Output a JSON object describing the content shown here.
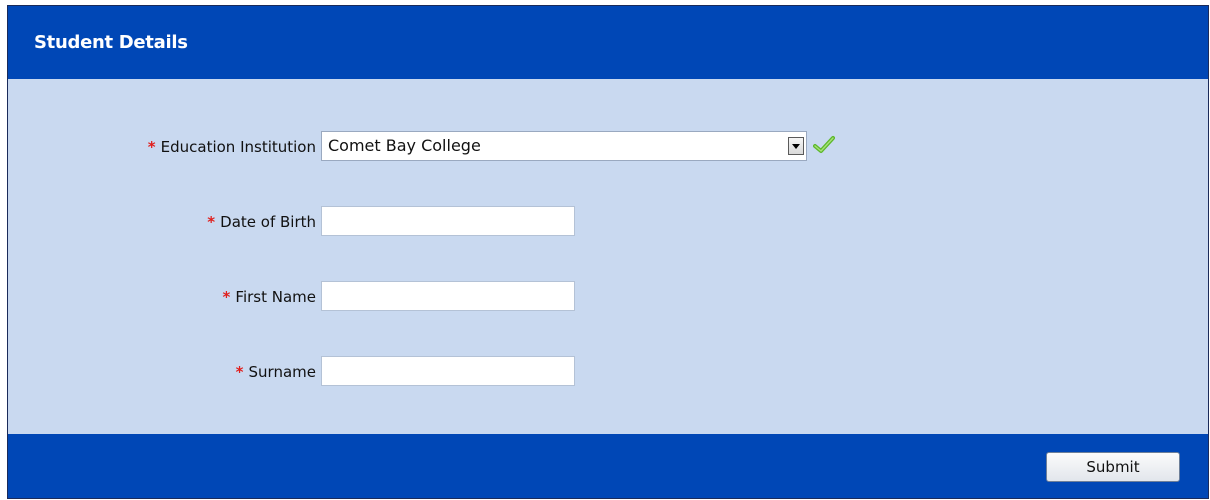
{
  "header": {
    "title": "Student Details"
  },
  "form": {
    "required_marker": "*",
    "institution": {
      "label": "Education Institution",
      "selected_value": "Comet Bay College"
    },
    "dob": {
      "label": "Date of Birth",
      "value": ""
    },
    "first_name": {
      "label": "First Name",
      "value": ""
    },
    "surname": {
      "label": "Surname",
      "value": ""
    }
  },
  "footer": {
    "submit_label": "Submit"
  },
  "colors": {
    "header_bg": "#0047b6",
    "panel_bg": "#c9d9f0",
    "required": "#e0201e",
    "valid_check": "#5cb82a"
  },
  "icons": {
    "institution_status": "checkmark-icon",
    "dropdown": "chevron-down-icon"
  }
}
